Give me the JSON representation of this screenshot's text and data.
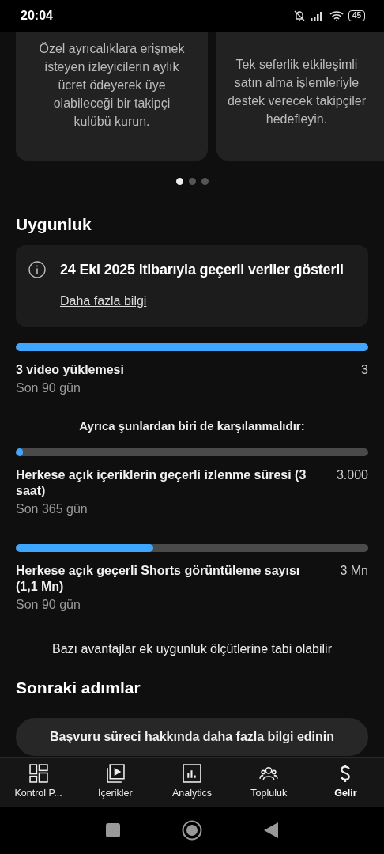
{
  "status_bar": {
    "time": "20:04",
    "battery": "45"
  },
  "cards": [
    {
      "lines": [
        "Özel ayrıcalıklara erişmek",
        "isteyen izleyicilerin aylık",
        "ücret ödeyerek üye",
        "olabileceği bir takipçi",
        "kulübü kurun."
      ]
    },
    {
      "lines": [
        "Tek seferlik etkileşimli",
        "satın alma işlemleriyle",
        "destek verecek takipçiler",
        "hedefleyin."
      ]
    }
  ],
  "pager_dots": [
    {
      "selected": true
    },
    {
      "selected": false
    },
    {
      "selected": false
    }
  ],
  "eligibility": {
    "title": "Uygunluk",
    "info": {
      "text": "24 Eki 2025 itibarıyla geçerli veriler gösteril",
      "link": "Daha fazla bilgi"
    },
    "requirements": [
      {
        "label": "3 video yüklemesi",
        "value": "3",
        "period": "Son 90 gün",
        "level": 1
      }
    ],
    "alternatives_note": "Ayrıca şunlardan biri de karşılanmalıdır:",
    "alternatives": [
      {
        "label": "Herkese açık içeriklerin geçerli izlenme süresi (3 saat)",
        "value": "3.000",
        "period": "Son 365 gün",
        "level": 0.02
      },
      {
        "label": "Herkese açık geçerli Shorts görüntüleme sayısı (1,1 Mn)",
        "value": "3 Mn",
        "period": "Son 90 gün",
        "level": 0.39
      }
    ],
    "footnote": "Bazı avantajlar ek uygunluk ölçütlerine tabi olabilir"
  },
  "next_steps": {
    "title": "Sonraki adımlar",
    "button": "Başvuru süreci hakkında daha fazla bilgi edinin"
  },
  "bottom_nav": [
    {
      "label": "Kontrol P...",
      "selected": false
    },
    {
      "label": "İçerikler",
      "selected": false
    },
    {
      "label": "Analytics",
      "selected": false
    },
    {
      "label": "Topluluk",
      "selected": false
    },
    {
      "label": "Gelir",
      "selected": true
    }
  ]
}
